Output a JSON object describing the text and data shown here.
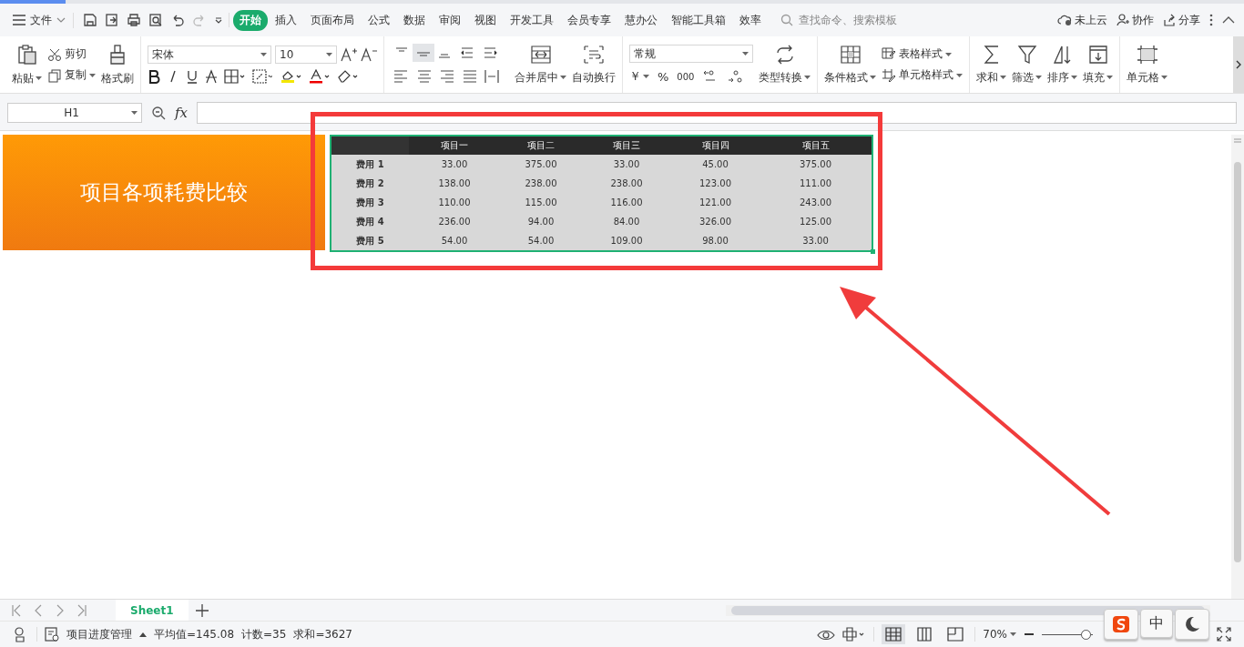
{
  "menu": {
    "file": "文件",
    "tabs": [
      {
        "label": "开始",
        "selected": true
      },
      {
        "label": "插入",
        "selected": false
      },
      {
        "label": "页面布局",
        "selected": false
      },
      {
        "label": "公式",
        "selected": false
      },
      {
        "label": "数据",
        "selected": false
      },
      {
        "label": "审阅",
        "selected": false
      },
      {
        "label": "视图",
        "selected": false
      },
      {
        "label": "开发工具",
        "selected": false
      },
      {
        "label": "会员专享",
        "selected": false
      },
      {
        "label": "慧办公",
        "selected": false
      },
      {
        "label": "智能工具箱",
        "selected": false
      },
      {
        "label": "效率",
        "selected": false
      }
    ],
    "search": {
      "placeholder": "查找命令、搜索模板"
    },
    "cloud": "未上云",
    "collaborate": "协作",
    "share": "分享"
  },
  "ribbon": {
    "paste": "粘贴",
    "cut": "剪切",
    "copy": "复制",
    "format_painter": "格式刷",
    "font": "宋体",
    "font_size": "10",
    "merge_center": "合并居中",
    "wrap_text": "自动换行",
    "number_format": "常规",
    "currency": "￥",
    "percent": "%",
    "thousands": "000",
    "type_convert": "类型转换",
    "conditional_format": "条件格式",
    "table_style": "表格样式",
    "cell_style": "单元格样式",
    "sum": "求和",
    "filter": "筛选",
    "sort": "排序",
    "fill": "填充",
    "cell": "单元格"
  },
  "formula_bar": {
    "name_box": "H1",
    "fx": "fx"
  },
  "sheet": {
    "title": "项目各项耗费比较",
    "table": {
      "columns": [
        "项目一",
        "项目二",
        "项目三",
        "项目四",
        "项目五"
      ],
      "rows": [
        {
          "label": "费用 1",
          "values": [
            "33.00",
            "375.00",
            "33.00",
            "45.00",
            "375.00"
          ]
        },
        {
          "label": "费用 2",
          "values": [
            "138.00",
            "238.00",
            "238.00",
            "123.00",
            "111.00"
          ]
        },
        {
          "label": "费用 3",
          "values": [
            "110.00",
            "115.00",
            "116.00",
            "121.00",
            "243.00"
          ]
        },
        {
          "label": "费用 4",
          "values": [
            "236.00",
            "94.00",
            "84.00",
            "326.00",
            "125.00"
          ]
        },
        {
          "label": "费用 5",
          "values": [
            "54.00",
            "54.00",
            "109.00",
            "98.00",
            "33.00"
          ]
        }
      ]
    }
  },
  "sheet_tabs": [
    {
      "label": "Sheet1",
      "selected": true
    }
  ],
  "status_bar": {
    "workbook": "项目进度管理",
    "average": "平均值=145.08",
    "count": "计数=35",
    "sum": "求和=3627",
    "zoom": "70%",
    "zoom_slider": {
      "level": 0.95
    },
    "views": [
      {
        "selected": true
      },
      {
        "selected": false
      },
      {
        "selected": false
      }
    ]
  },
  "ime": {
    "mode": "中"
  }
}
